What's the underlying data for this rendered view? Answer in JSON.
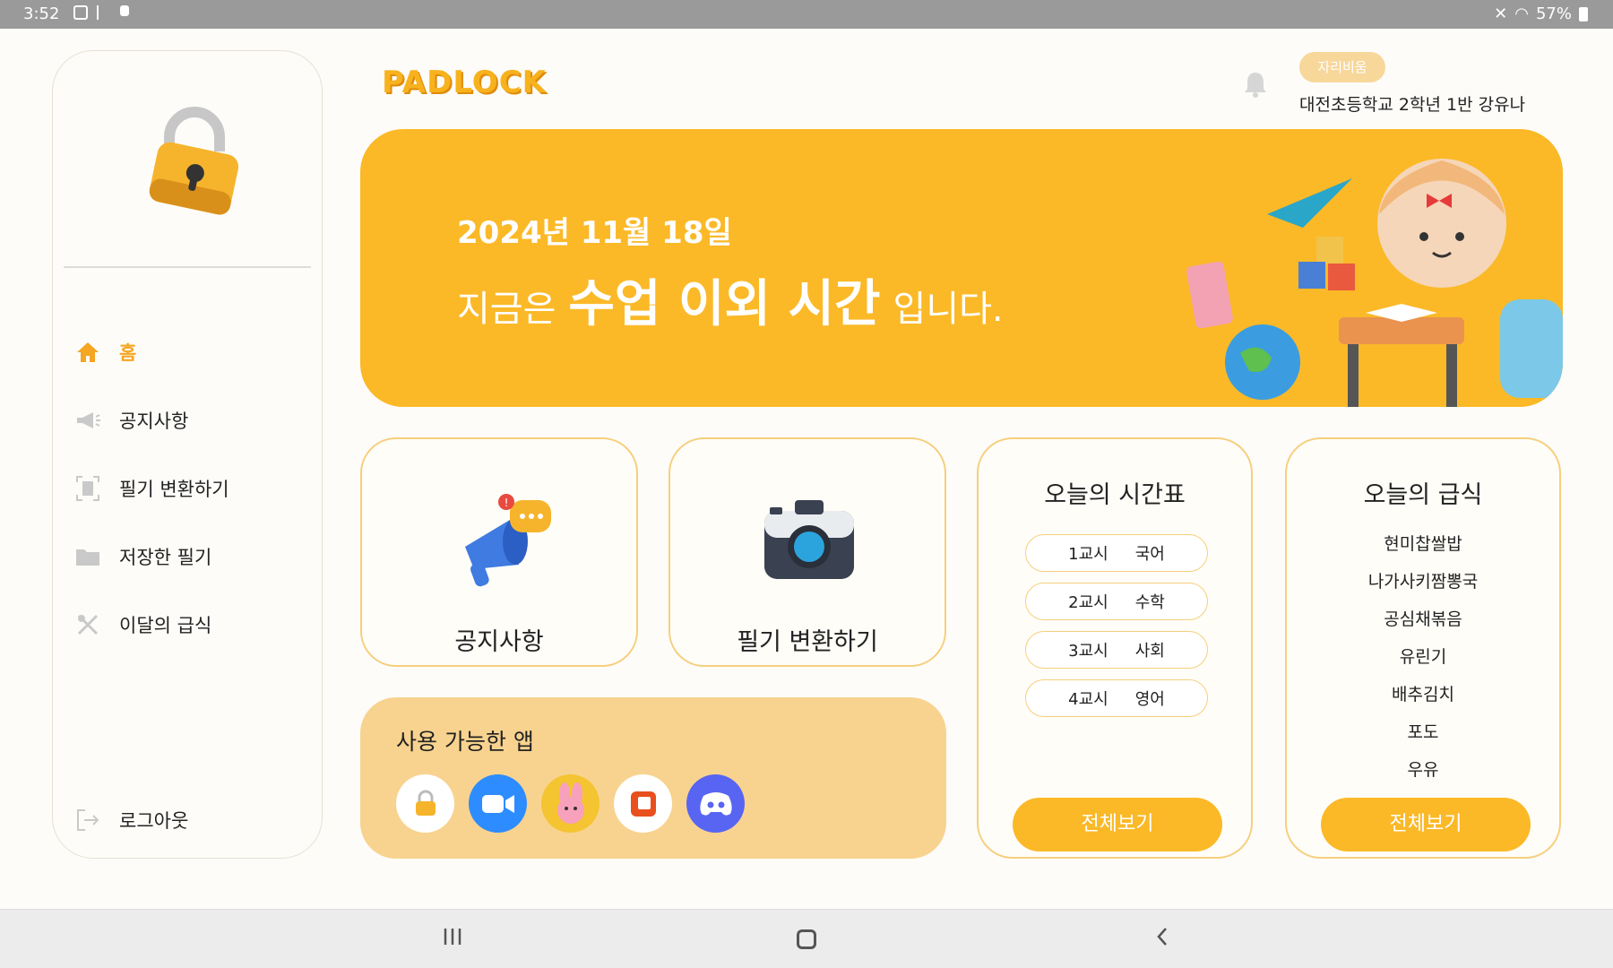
{
  "status_bar": {
    "time": "3:52",
    "battery": "57%"
  },
  "header": {
    "brand": "PADLOCK",
    "badge": "자리비움",
    "user_info": "대전초등학교 2학년 1반 강유나"
  },
  "sidebar": {
    "items": [
      {
        "label": "홈",
        "icon": "home-icon",
        "active": true
      },
      {
        "label": "공지사항",
        "icon": "megaphone-icon",
        "active": false
      },
      {
        "label": "필기 변환하기",
        "icon": "scan-icon",
        "active": false
      },
      {
        "label": "저장한 필기",
        "icon": "folder-icon",
        "active": false
      },
      {
        "label": "이달의 급식",
        "icon": "utensils-icon",
        "active": false
      }
    ],
    "logout_label": "로그아웃"
  },
  "banner": {
    "date": "2024년 11월 18일",
    "prefix": "지금은",
    "highlight": "수업 이외 시간",
    "suffix": "입니다."
  },
  "cards": {
    "notice_label": "공지사항",
    "convert_label": "필기 변환하기"
  },
  "apps": {
    "title": "사용 가능한 앱",
    "items": [
      {
        "name": "PADLOCK",
        "icon": "padlock-app-icon"
      },
      {
        "name": "Zoom",
        "icon": "zoom-app-icon"
      },
      {
        "name": "Bunny game",
        "icon": "bunny-app-icon"
      },
      {
        "name": "Office",
        "icon": "office-app-icon"
      },
      {
        "name": "Discord",
        "icon": "discord-app-icon"
      }
    ]
  },
  "timetable": {
    "title": "오늘의 시간표",
    "rows": [
      {
        "period": "1교시",
        "subject": "국어"
      },
      {
        "period": "2교시",
        "subject": "수학"
      },
      {
        "period": "3교시",
        "subject": "사회"
      },
      {
        "period": "4교시",
        "subject": "영어"
      }
    ],
    "view_all": "전체보기"
  },
  "meal": {
    "title": "오늘의 급식",
    "items": [
      "현미찹쌀밥",
      "나가사키짬뽕국",
      "공심채볶음",
      "유린기",
      "배추김치",
      "포도",
      "우유"
    ],
    "view_all": "전체보기"
  },
  "colors": {
    "accent": "#fbb928",
    "accent_light": "#f8d38f",
    "border": "#f6cf7d"
  }
}
